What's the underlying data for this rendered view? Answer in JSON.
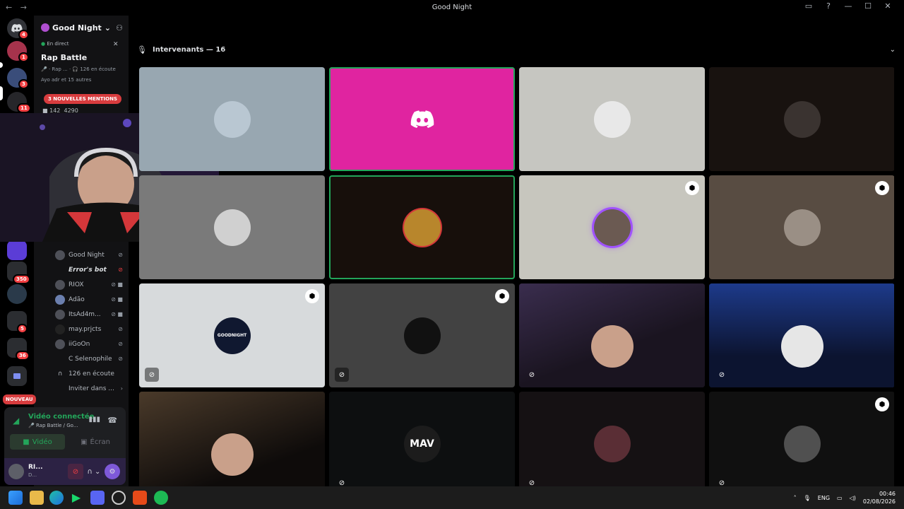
{
  "window": {
    "title": "Good Night",
    "nav": "← →"
  },
  "servers": {
    "badges": [
      "4",
      "1",
      "3",
      "11",
      "350",
      "5",
      "36"
    ],
    "new_label": "NOUVEAU"
  },
  "sidebar": {
    "guild_name": "Good Night",
    "live_label": "En direct",
    "stage_name": "Rap Battle",
    "stage_meta": "🎤 · Rap ...  · 🎧 126 en écoute",
    "audience": "Ayo adr et 15 autres",
    "mentions_banner": "3 NOUVELLES MENTIONS",
    "sub_counts": {
      "a": "142",
      "b": "4290"
    },
    "voice_users": [
      {
        "name": "Good Night",
        "bot": false
      },
      {
        "name": "Error's bot",
        "bot": true
      },
      {
        "name": "RIOX",
        "bot": false
      },
      {
        "name": "Adão",
        "bot": false
      },
      {
        "name": "ItsAd4m...",
        "bot": false
      },
      {
        "name": "may.prjcts",
        "bot": false
      },
      {
        "name": "iiGoOn",
        "bot": false
      },
      {
        "name": "C Selenophile",
        "bot": false
      }
    ],
    "listening": "126 en écoute",
    "invite": "Inviter dans ..."
  },
  "voice_panel": {
    "status": "Vidéo connectée",
    "sub": "🎤 Rap Battle / Go...",
    "video_btn": "Vidéo",
    "screen_btn": "Écran",
    "user_name": "RI...",
    "user_status": "D..."
  },
  "stage": {
    "header": "Intervenants — 16"
  },
  "tiles": [
    {
      "bg": "#98a7b1",
      "mod": false,
      "mute": "none",
      "label": ""
    },
    {
      "bg": "#e024a0",
      "mod": false,
      "mute": "none",
      "label": "discord",
      "speaking": true
    },
    {
      "bg": "#c6c6c1",
      "mod": false,
      "mute": "none",
      "label": ""
    },
    {
      "bg": "#18120f",
      "mod": false,
      "mute": "none",
      "label": ""
    },
    {
      "bg": "#7a7a7a",
      "mod": false,
      "mute": "none",
      "label": ""
    },
    {
      "bg": "#170f0b",
      "mod": false,
      "mute": "none",
      "label": "",
      "speaking": true
    },
    {
      "bg": "#c7c6be",
      "mod": true,
      "mute": "none",
      "label": ""
    },
    {
      "bg": "#584c42",
      "mod": true,
      "mute": "none",
      "label": ""
    },
    {
      "bg": "#d7dadc",
      "mod": true,
      "mute": "box",
      "label": "GOODNIGHT"
    },
    {
      "bg": "#424242",
      "mod": true,
      "mute": "box",
      "label": ""
    },
    {
      "bg": "#2a1e2c",
      "mod": false,
      "mute": "plain",
      "label": ""
    },
    {
      "bg": "#1a2b52",
      "mod": false,
      "mute": "plain",
      "label": ""
    },
    {
      "bg": "#2b2420",
      "mod": false,
      "mute": "none",
      "label": ""
    },
    {
      "bg": "#0d0f10",
      "mod": false,
      "mute": "plain",
      "label": "MAV"
    },
    {
      "bg": "#151113",
      "mod": false,
      "mute": "plain",
      "label": ""
    },
    {
      "bg": "#101010",
      "mod": true,
      "mute": "plain",
      "label": ""
    }
  ],
  "taskbar": {
    "lang": "ENG",
    "time": "00:46",
    "date": "02/08/2026"
  }
}
